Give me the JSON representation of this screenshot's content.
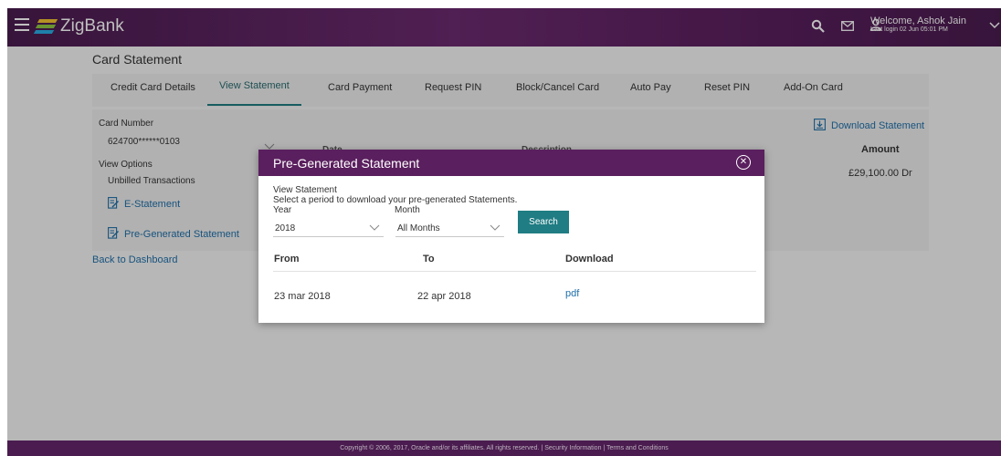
{
  "header": {
    "brand": "ZigBank",
    "welcome": "Welcome, Ashok Jain",
    "last_login": "Last login 02 Jun 05:01 PM",
    "icons": [
      "menu-icon",
      "search-icon",
      "mail-icon",
      "user-icon",
      "chevron-down-icon"
    ]
  },
  "page": {
    "title": "Card Statement"
  },
  "tabs": [
    {
      "label": "Credit Card Details"
    },
    {
      "label": "View Statement"
    },
    {
      "label": "Card Payment"
    },
    {
      "label": "Request PIN"
    },
    {
      "label": "Block/Cancel Card"
    },
    {
      "label": "Auto Pay"
    },
    {
      "label": "Reset PIN"
    },
    {
      "label": "Add-On Card"
    }
  ],
  "panel": {
    "card_number_label": "Card Number",
    "card_number_value": "624700******0103",
    "view_options_label": "View Options",
    "view_options_value": "Unbilled Transactions",
    "e_statement": "E-Statement",
    "pre_generated": "Pre-Generated Statement",
    "download_statement": "Download Statement",
    "bg_col_date": "Date",
    "bg_col_description": "Description",
    "amount_header": "Amount",
    "amount_value": "£29,100.00 Dr"
  },
  "back_link": "Back to Dashboard",
  "modal": {
    "title": "Pre-Generated Statement",
    "subtitle": "View Statement",
    "instruction": "Select a period to download your pre-generated Statements.",
    "year_label": "Year",
    "year_value": "2018",
    "month_label": "Month",
    "month_value": "All Months",
    "search_label": "Search",
    "columns": {
      "from": "From",
      "to": "To",
      "download": "Download"
    },
    "rows": [
      {
        "from": "23 mar 2018",
        "to": "22 apr 2018",
        "download": "pdf"
      }
    ]
  },
  "footer": {
    "text": "Copyright © 2006, 2017, Oracle and/or its affiliates. All rights reserved. | Security Information | Terms and Conditions"
  },
  "colors": {
    "brand": "#5a1f5e",
    "accent": "#1f7d83",
    "link": "#1f6fa8"
  }
}
